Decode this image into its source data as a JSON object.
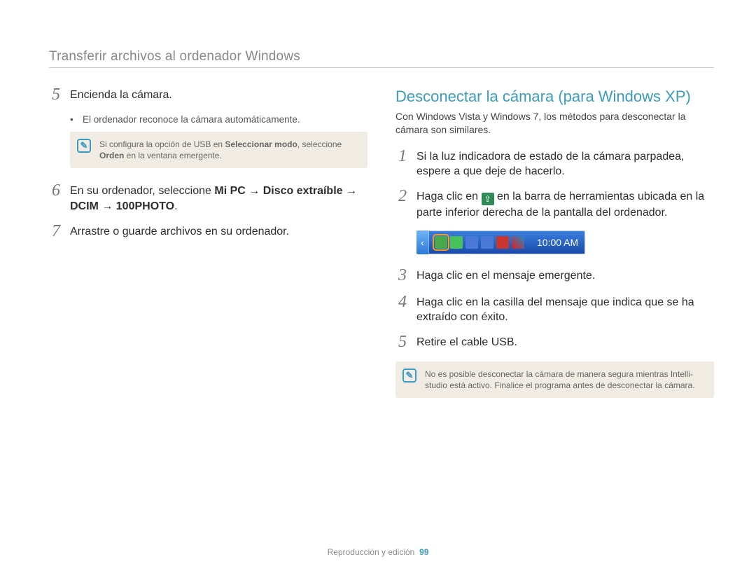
{
  "header": {
    "breadcrumb": "Transferir archivos al ordenador Windows"
  },
  "left": {
    "steps": {
      "s5": {
        "num": "5",
        "text": "Encienda la cámara."
      },
      "s5_bullet": "El ordenador reconoce la cámara automáticamente.",
      "s5_note_a": "Si configura la opción de USB en ",
      "s5_note_bold1": "Seleccionar modo",
      "s5_note_b": ", seleccione ",
      "s5_note_bold2": "Orden",
      "s5_note_c": " en la ventana emergente.",
      "s6": {
        "num": "6",
        "text_a": "En su ordenador, seleccione ",
        "bold1": "Mi PC",
        "arrow1": " → ",
        "bold2": "Disco extraíble",
        "arrow2": " → ",
        "bold3": "DCIM",
        "arrow3": " → ",
        "bold4": "100PHOTO",
        "dot": "."
      },
      "s7": {
        "num": "7",
        "text": "Arrastre o guarde archivos en su ordenador."
      }
    }
  },
  "right": {
    "title": "Desconectar la cámara (para Windows XP)",
    "subtitle": "Con Windows Vista y Windows 7, los métodos para desconectar la cámara son similares.",
    "steps": {
      "s1": {
        "num": "1",
        "text": "Si la luz indicadora de estado de la cámara parpadea, espere a que deje de hacerlo."
      },
      "s2": {
        "num": "2",
        "text_a": "Haga clic en ",
        "text_b": " en la barra de herramientas ubicada en la parte inferior derecha de la pantalla del ordenador."
      },
      "s3": {
        "num": "3",
        "text": "Haga clic en el mensaje emergente."
      },
      "s4": {
        "num": "4",
        "text": "Haga clic en la casilla del mensaje que indica que se ha extraído con éxito."
      },
      "s5": {
        "num": "5",
        "text": "Retire el cable USB."
      }
    },
    "taskbar": {
      "time": "10:00 AM"
    },
    "note": "No es posible desconectar la cámara de manera segura mientras Intelli-studio está activo. Finalice el programa antes de desconectar la cámara."
  },
  "footer": {
    "section": "Reproducción y edición",
    "page": "99"
  }
}
